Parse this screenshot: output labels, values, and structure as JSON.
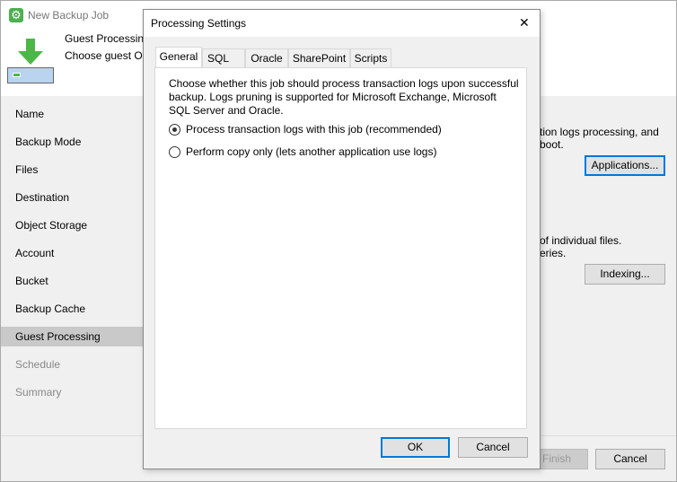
{
  "window": {
    "title": "New Backup Job",
    "header_title": "Guest Processing",
    "header_subtitle": "Choose guest OS processing options available for running VMs."
  },
  "nav": [
    {
      "label": "Name"
    },
    {
      "label": "Backup Mode"
    },
    {
      "label": "Files"
    },
    {
      "label": "Destination"
    },
    {
      "label": "Object Storage"
    },
    {
      "label": "Account"
    },
    {
      "label": "Bucket"
    },
    {
      "label": "Backup Cache"
    },
    {
      "label": "Guest Processing"
    },
    {
      "label": "Schedule"
    },
    {
      "label": "Summary"
    }
  ],
  "main": {
    "text1_line1": "tion logs processing, and",
    "text1_line2": "boot.",
    "applications_button": "Applications...",
    "text2_line1": "of individual files.",
    "text2_line2": "eries.",
    "indexing_button": "Indexing..."
  },
  "footer": {
    "finish": "Finish",
    "cancel": "Cancel"
  },
  "dialog": {
    "title": "Processing Settings",
    "close": "✕",
    "tabs": [
      "General",
      "SQL",
      "Oracle",
      "SharePoint",
      "Scripts"
    ],
    "description": [
      "Choose whether this job should process transaction logs upon successful",
      "backup. Logs pruning is supported for Microsoft Exchange, Microsoft",
      "SQL Server and Oracle."
    ],
    "options": [
      {
        "label": "Process transaction logs with this job (recommended)",
        "selected": true
      },
      {
        "label": "Perform copy only (lets another application use logs)",
        "selected": false
      }
    ],
    "ok": "OK",
    "cancel": "Cancel"
  }
}
